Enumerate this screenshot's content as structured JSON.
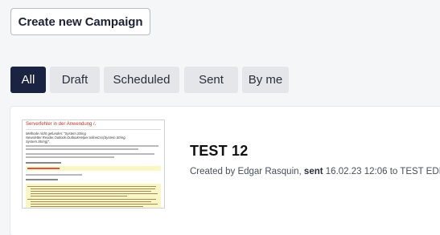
{
  "toolbar": {
    "create_label": "Create new Campaign"
  },
  "tabs": [
    {
      "label": "All",
      "active": true
    },
    {
      "label": "Draft",
      "active": false
    },
    {
      "label": "Scheduled",
      "active": false
    },
    {
      "label": "Sent",
      "active": false
    },
    {
      "label": "By me",
      "active": false
    }
  ],
  "campaign": {
    "title": "TEST 12",
    "created_prefix": "Created by Edgar Rasquin,",
    "status": "sent",
    "date_suffix": "16.02.23 12:06 to TEST EDI",
    "thumbnail": {
      "heading": "Serverfehler in der Anwendung /.",
      "message": "Methode nicht gefunden: \"System.String Newsletter.Reader.Outlook.OutlookHelper.InlineCss(System.String, System.String)\"."
    }
  },
  "colors": {
    "active_tab": "#1a2442",
    "tab_bg": "#e4e6ea",
    "page_bg": "#f5f6f8"
  }
}
